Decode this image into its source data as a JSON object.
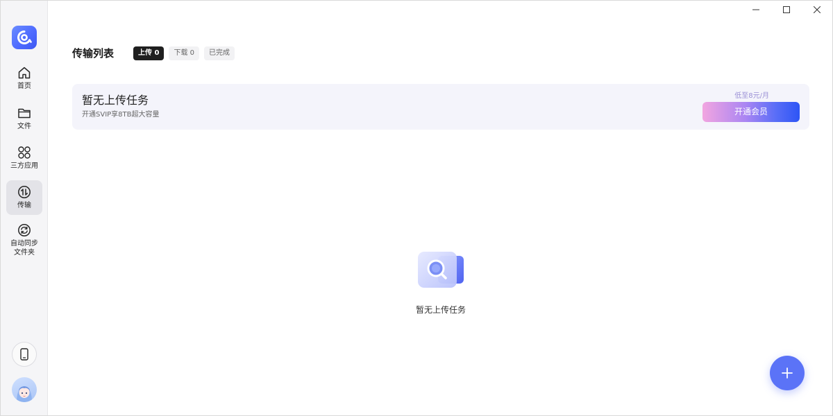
{
  "sidebar": {
    "items": [
      {
        "label": "首页",
        "icon": "home-icon"
      },
      {
        "label": "文件",
        "icon": "folder-icon"
      },
      {
        "label": "三方应用",
        "icon": "apps-icon"
      },
      {
        "label": "传输",
        "icon": "transfer-icon"
      },
      {
        "label": "自动同步\n文件夹",
        "icon": "sync-icon"
      }
    ],
    "active_index": 3
  },
  "header": {
    "title": "传输列表",
    "tabs": [
      {
        "label": "上传 0"
      },
      {
        "label": "下载 0"
      },
      {
        "label": "已完成"
      }
    ]
  },
  "banner": {
    "title": "暂无上传任务",
    "subtitle": "开通SVIP享8TB超大容量",
    "promo_note": "低至8元/月",
    "vip_button": "开通会员"
  },
  "empty_state": {
    "text": "暂无上传任务",
    "icon": "search-document-icon"
  },
  "fab": {
    "icon": "plus-icon"
  },
  "colors": {
    "accent": "#5b73f7",
    "sidebar_bg": "#f5f5f7",
    "banner_bg": "#f4f4fb",
    "active_tab": "#1f1f1f"
  }
}
